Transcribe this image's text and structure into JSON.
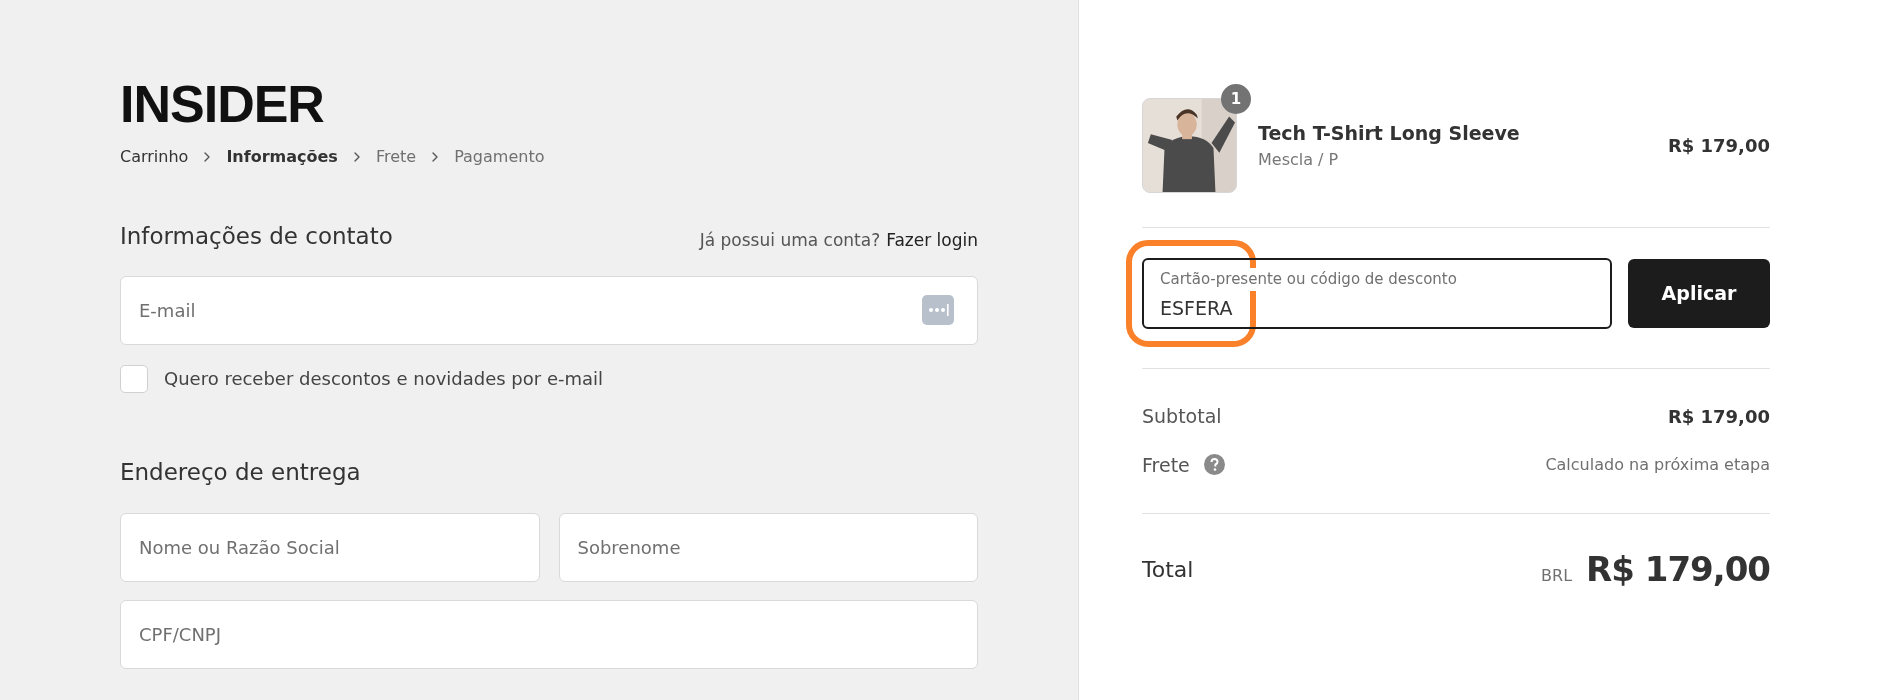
{
  "logo": "INSIDER",
  "breadcrumb": [
    {
      "label": "Carrinho",
      "selected": false,
      "completed": true
    },
    {
      "label": "Informações",
      "selected": true,
      "completed": false
    },
    {
      "label": "Frete",
      "selected": false,
      "completed": false
    },
    {
      "label": "Pagamento",
      "selected": false,
      "completed": false
    }
  ],
  "contact": {
    "heading": "Informações de contato",
    "login_prompt": "Já possui uma conta?",
    "login_link": "Fazer login",
    "email": {
      "placeholder": "E-mail"
    },
    "newsletter": {
      "label": "Quero receber descontos e novidades por e-mail",
      "checked": false
    }
  },
  "shipping": {
    "heading": "Endereço de entrega",
    "rows": [
      {
        "fields": [
          {
            "placeholder": "Nome ou Razão Social"
          },
          {
            "placeholder": "Sobrenome"
          }
        ]
      },
      {
        "fields": [
          {
            "placeholder": "CPF/CNPJ"
          }
        ]
      }
    ]
  },
  "cart": {
    "items": [
      {
        "name": "Tech T-Shirt Long Sleeve",
        "variant": "Mescla / P",
        "quantity": "1",
        "price": "R$ 179,00"
      }
    ]
  },
  "discount": {
    "label": "Cartão-presente ou código de desconto",
    "value": "ESFERA",
    "highlighted": true,
    "button": "Aplicar"
  },
  "summary": {
    "rows": [
      {
        "label": "Subtotal",
        "value": "R$ 179,00",
        "kind": "amount"
      },
      {
        "label": "Frete",
        "value": "Calculado na próxima etapa",
        "kind": "note"
      }
    ],
    "total": {
      "label": "Total",
      "currency": "BRL",
      "value": "R$ 179,00"
    }
  }
}
